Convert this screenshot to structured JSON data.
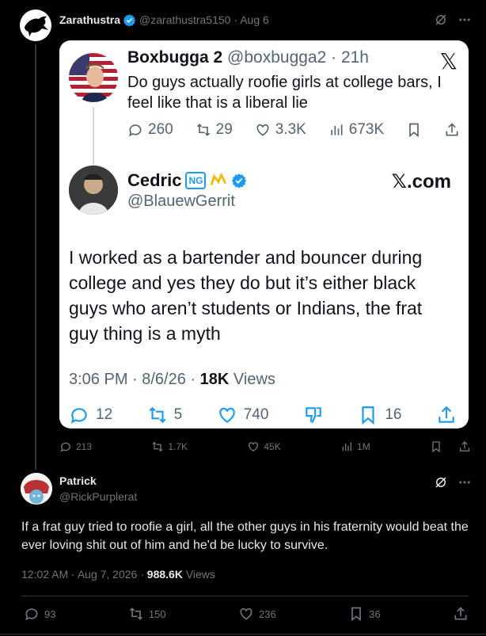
{
  "parent": {
    "name": "Zarathustra",
    "handle": "@zarathustra5150",
    "time": "· Aug 6",
    "actions": {
      "replies": "213",
      "reposts": "1.7K",
      "likes": "45K",
      "views": "1M"
    }
  },
  "card": {
    "quoted": {
      "name": "Boxbugga 2",
      "handle": "@boxbugga2 · 21h",
      "text": "Do guys actually roofie girls at college bars, I feel like that is a liberal lie",
      "replies": "260",
      "reposts": "29",
      "likes": "3.3K",
      "views": "673K"
    },
    "reply": {
      "name": "Cedric",
      "badge": "NG",
      "handle": "@BlauewGerrit",
      "source": "𝕏.com",
      "text": "I worked as a bartender and bouncer during college and yes they do but it’s either black guys who aren’t students or Indians, the frat guy thing is a myth",
      "time": "3:06 PM · 8/6/26 · ",
      "views_count": "18K",
      "views_label": " Views",
      "replies": "12",
      "reposts": "5",
      "likes": "740",
      "bookmarks": "16"
    }
  },
  "reply": {
    "name": "Patrick",
    "handle": "@RickPurplerat",
    "text": "If a frat guy tried to roofie a girl, all the other guys in his fraternity would beat the ever loving shit out of him and he'd be lucky to survive.",
    "time": "12:02 AM · Aug 7, 2026 · ",
    "views_count": "988.6K",
    "views_label": " Views",
    "actions": {
      "replies": "93",
      "reposts": "150",
      "likes": "236",
      "bookmarks": "36"
    }
  },
  "colors": {
    "background": "#000000",
    "verified": "#1d9bf0",
    "muted": "#71767b"
  }
}
